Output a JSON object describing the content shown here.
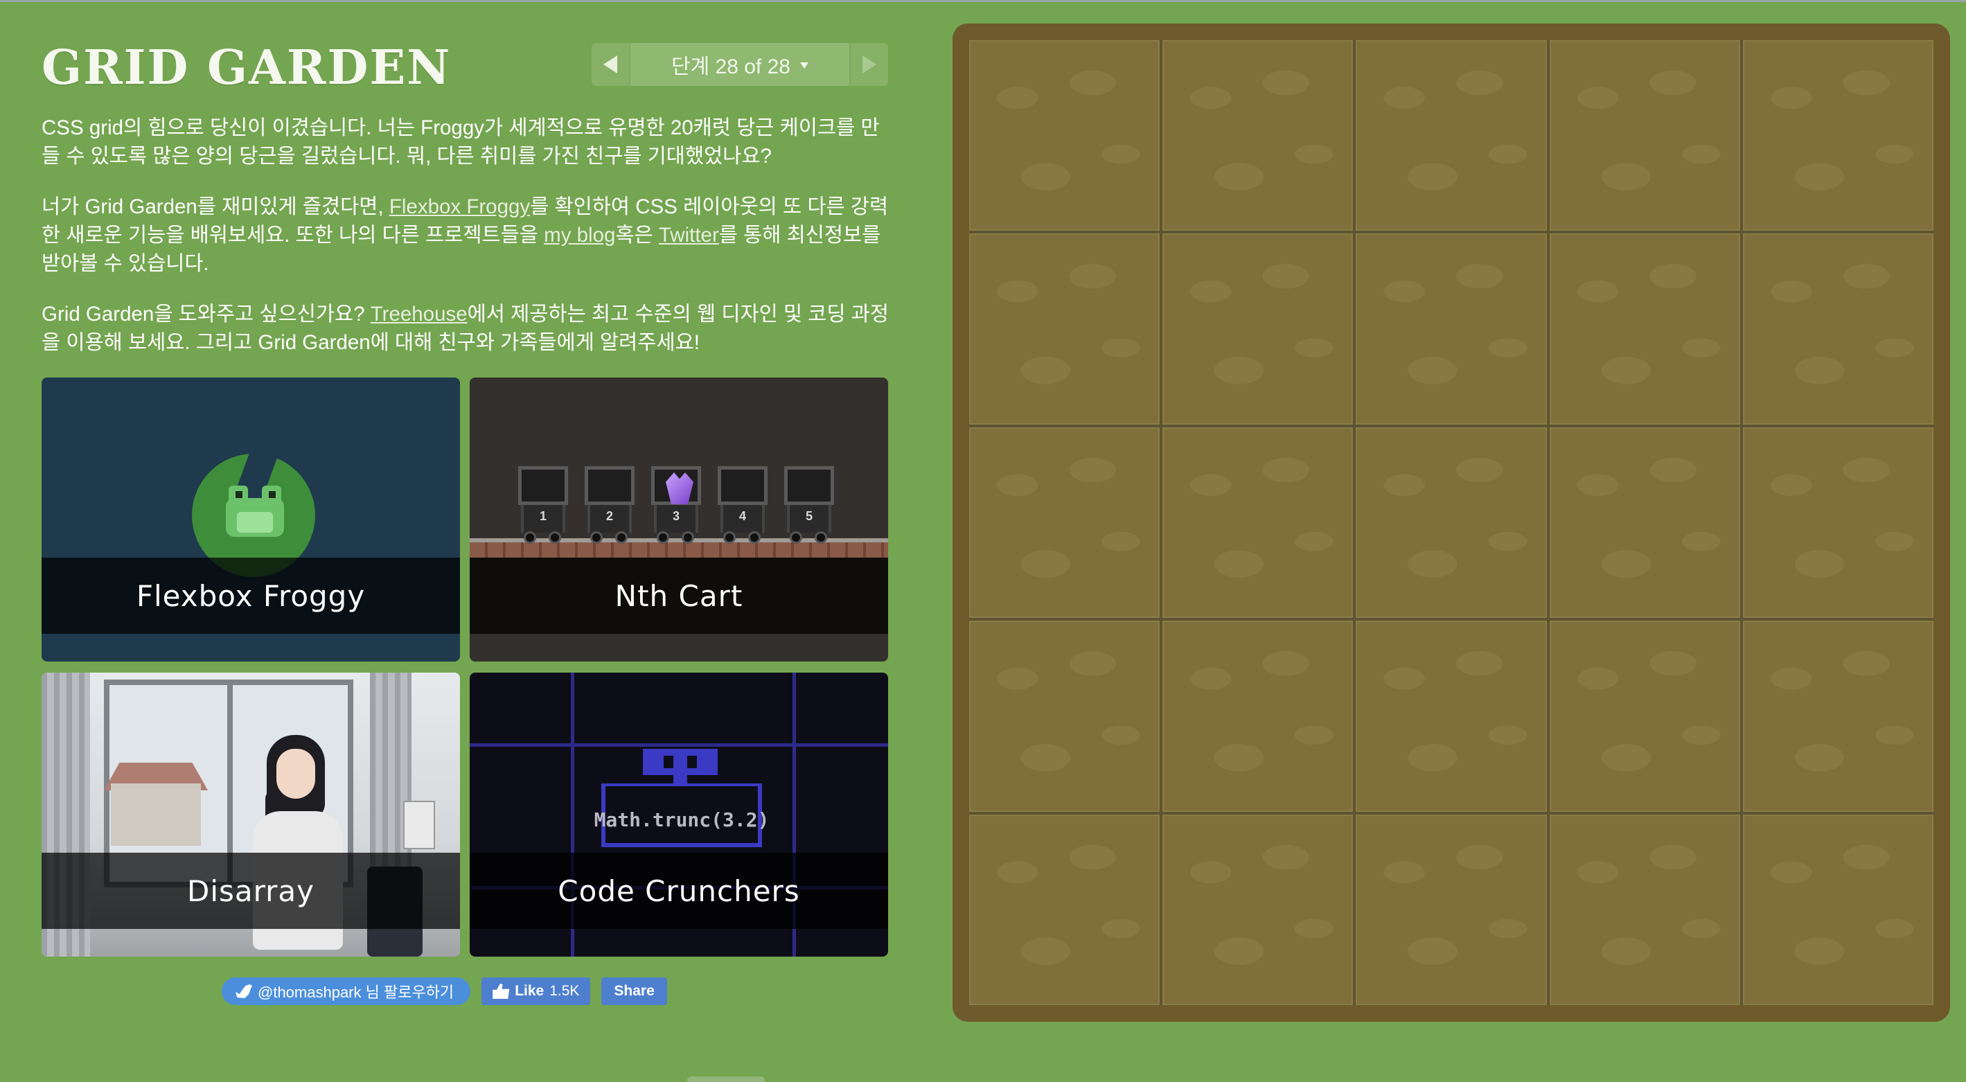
{
  "app": {
    "title": "GRID GARDEN"
  },
  "level_nav": {
    "indicator": "단계 28 of 28",
    "prev_icon": "triangle-left-icon",
    "next_icon": "triangle-right-icon",
    "dropdown_icon": "caret-down-icon"
  },
  "intro": {
    "p1": "CSS grid의 힘으로 당신이 이겼습니다. 너는 Froggy가 세계적으로 유명한 20캐럿 당근 케이크를 만들 수 있도록 많은 양의 당근을 길렀습니다. 뭐, 다른 취미를 가진 친구를 기대했었나요?",
    "p2_a": "너가 Grid Garden를 재미있게 즐겼다면, ",
    "p2_link1": "Flexbox Froggy",
    "p2_b": "를 확인하여 CSS 레이아웃의 또 다른 강력한 새로운 기능을 배워보세요. 또한 나의 다른 프로젝트들을 ",
    "p2_link2": "my blog",
    "p2_c": "혹은 ",
    "p2_link3": "Twitter",
    "p2_d": "를 통해 최신정보를 받아볼 수 있습니다.",
    "p3_a": "Grid Garden을 도와주고 싶으신가요? ",
    "p3_link": "Treehouse",
    "p3_b": "에서 제공하는 최고 수준의 웹 디자인 및 코딩 과정을 이용해 보세요. 그리고 Grid Garden에 대해 친구와 가족들에게 알려주세요!"
  },
  "games": [
    {
      "label": "Flexbox Froggy"
    },
    {
      "label": "Nth Cart"
    },
    {
      "label": "Disarray"
    },
    {
      "label": "Code Crunchers"
    }
  ],
  "nth_cart": {
    "cart_numbers": [
      "1",
      "2",
      "3",
      "4",
      "5"
    ]
  },
  "code_crunchers": {
    "code": "Math.trunc(3.2)"
  },
  "social": {
    "twitter_follow": "@thomashpark 님 팔로우하기",
    "like_label": "Like",
    "like_count": "1.5K",
    "share_label": "Share"
  },
  "colors": {
    "background": "#74a550",
    "garden_border": "#6e5a2b",
    "soil": "#7e6f3b",
    "twitter": "#4b8fdc",
    "facebook": "#4e7fcf"
  },
  "garden": {
    "columns": 5,
    "rows": 5
  }
}
